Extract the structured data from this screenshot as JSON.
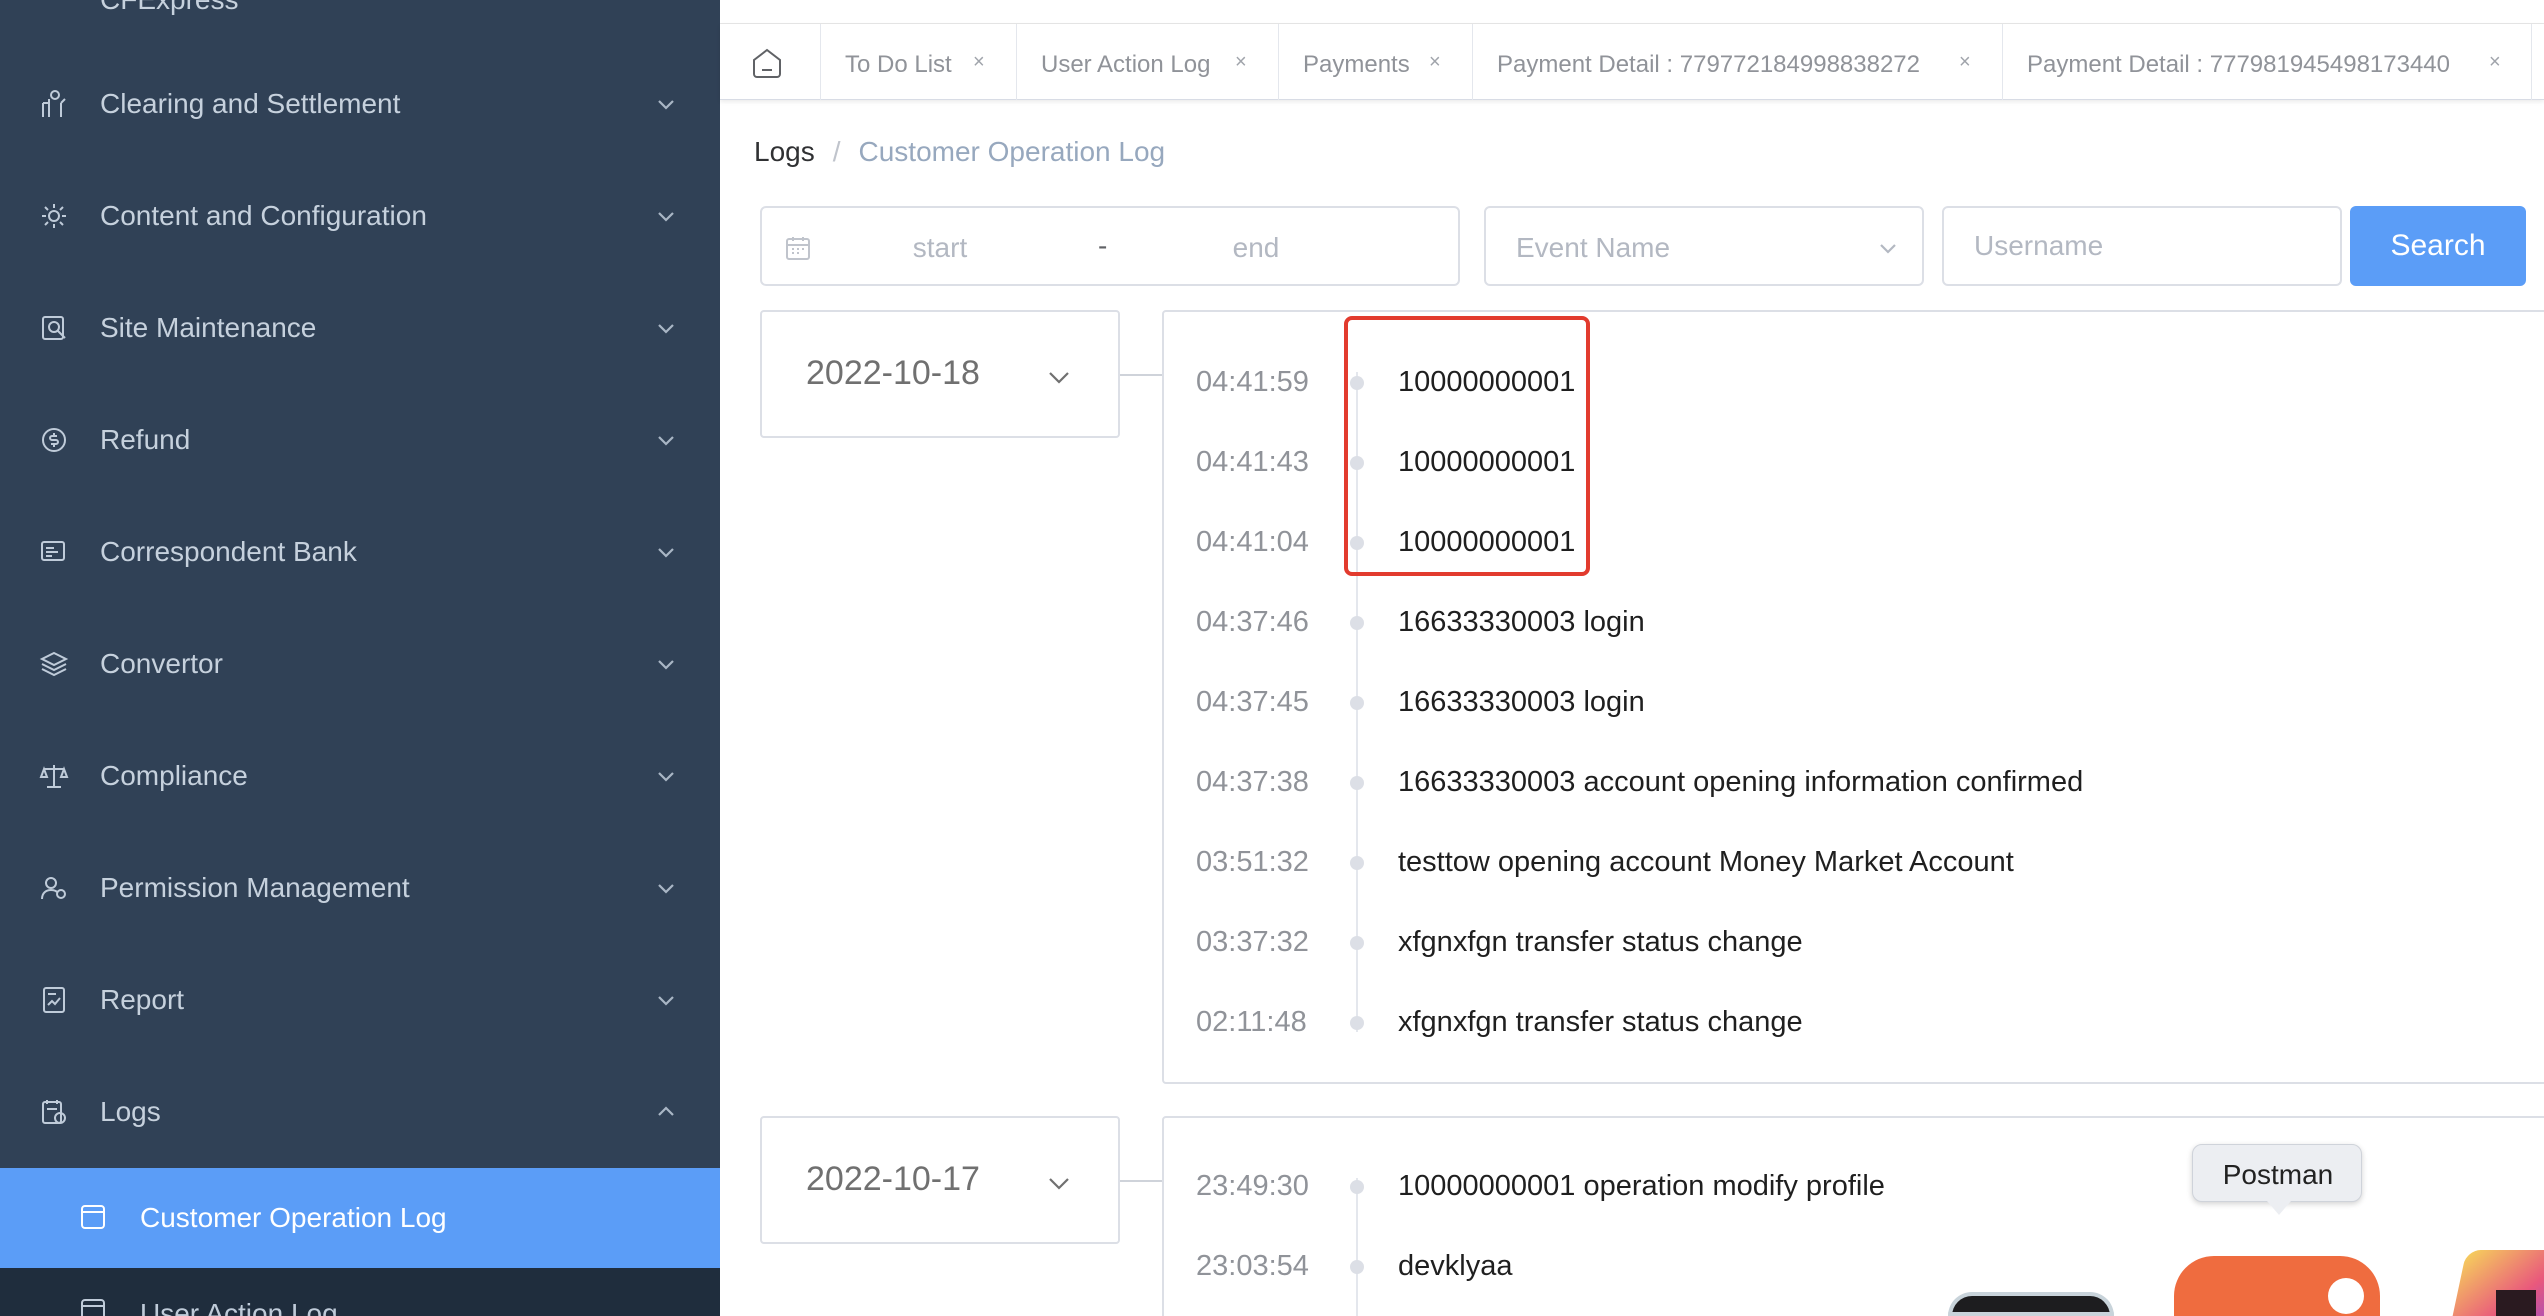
{
  "sidebar": {
    "partial_top_label": "CFExpress",
    "items": [
      {
        "label": "Clearing and Settlement",
        "icon": "clearing-icon"
      },
      {
        "label": "Content and Configuration",
        "icon": "gear-icon"
      },
      {
        "label": "Site Maintenance",
        "icon": "maintenance-icon"
      },
      {
        "label": "Refund",
        "icon": "refund-icon"
      },
      {
        "label": "Correspondent Bank",
        "icon": "bank-icon"
      },
      {
        "label": "Convertor",
        "icon": "layers-icon"
      },
      {
        "label": "Compliance",
        "icon": "scale-icon"
      },
      {
        "label": "Permission Management",
        "icon": "permission-icon"
      },
      {
        "label": "Report",
        "icon": "report-icon"
      },
      {
        "label": "Logs",
        "icon": "logs-icon"
      }
    ],
    "active_subitem": "Customer Operation Log",
    "next_subitem": "User Action Log"
  },
  "tabs": [
    {
      "label": "To Do List"
    },
    {
      "label": "User Action Log"
    },
    {
      "label": "Payments"
    },
    {
      "label": "Payment Detail : 779772184998838272"
    },
    {
      "label": "Payment Detail : 777981945498173440"
    }
  ],
  "breadcrumb": {
    "root": "Logs",
    "separator": "/",
    "current": "Customer Operation Log"
  },
  "filters": {
    "start_placeholder": "start",
    "range_separator": "-",
    "end_placeholder": "end",
    "event_placeholder": "Event Name",
    "username_placeholder": "Username",
    "search_label": "Search"
  },
  "groups": [
    {
      "date": "2022-10-18",
      "entries": [
        {
          "time": "04:41:59",
          "text": "10000000001"
        },
        {
          "time": "04:41:43",
          "text": "10000000001"
        },
        {
          "time": "04:41:04",
          "text": "10000000001"
        },
        {
          "time": "04:37:46",
          "text": "16633330003 login"
        },
        {
          "time": "04:37:45",
          "text": "16633330003 login"
        },
        {
          "time": "04:37:38",
          "text": "16633330003 account opening information confirmed"
        },
        {
          "time": "03:51:32",
          "text": "testtow opening account Money Market Account"
        },
        {
          "time": "03:37:32",
          "text": "xfgnxfgn transfer status change"
        },
        {
          "time": "02:11:48",
          "text": "xfgnxfgn transfer status change"
        }
      ]
    },
    {
      "date": "2022-10-17",
      "entries": [
        {
          "time": "23:49:30",
          "text": "10000000001 operation modify profile"
        },
        {
          "time": "23:03:54",
          "text": "devklyaa"
        }
      ]
    }
  ],
  "dock": {
    "tooltip": "Postman"
  },
  "colors": {
    "sidebar_bg": "#304156",
    "accent": "#5b9df7",
    "highlight": "#e23b2e"
  }
}
